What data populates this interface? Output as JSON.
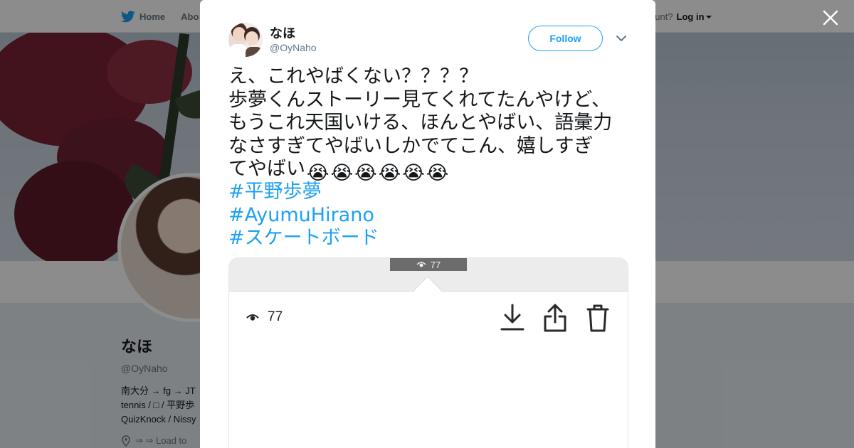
{
  "background_page": {
    "topbar": {
      "home_label": "Home",
      "about_label": "Abo",
      "account_prompt": "ccount?",
      "login_label": "Log in"
    },
    "profile": {
      "name": "なほ",
      "handle": "@OyNaho",
      "bio_lines": [
        "南大分 → fg → JT",
        "tennis / □ / 平野歩",
        "QuizKnock / Nissy"
      ],
      "location_text": "⇒ ⇒ Load to"
    }
  },
  "modal": {
    "close_label": "×",
    "tweet": {
      "author_name": "なほ",
      "author_handle": "@OyNaho",
      "follow_label": "Follow",
      "text": "え、これやばくない？？？？\n歩夢くんストーリー見てくれてたんやけど、\nもうこれ天国いける、ほんとやばい、語彙力\nなさすぎてやばいしかでてこん、嬉しすぎ\nてやばい",
      "emojis": [
        "😭",
        "😭",
        "😭",
        "😭",
        "😭",
        "😭"
      ],
      "hashtags": [
        "#平野歩夢",
        "#AyumuHirano",
        "#スケートボード"
      ]
    },
    "media": {
      "tooltip_count": "77",
      "view_count": "77",
      "icons": [
        "eye-icon",
        "download-icon",
        "share-icon",
        "trash-icon"
      ]
    }
  },
  "colors": {
    "accent": "#1da1f2",
    "text": "#14171a",
    "muted": "#657786"
  }
}
